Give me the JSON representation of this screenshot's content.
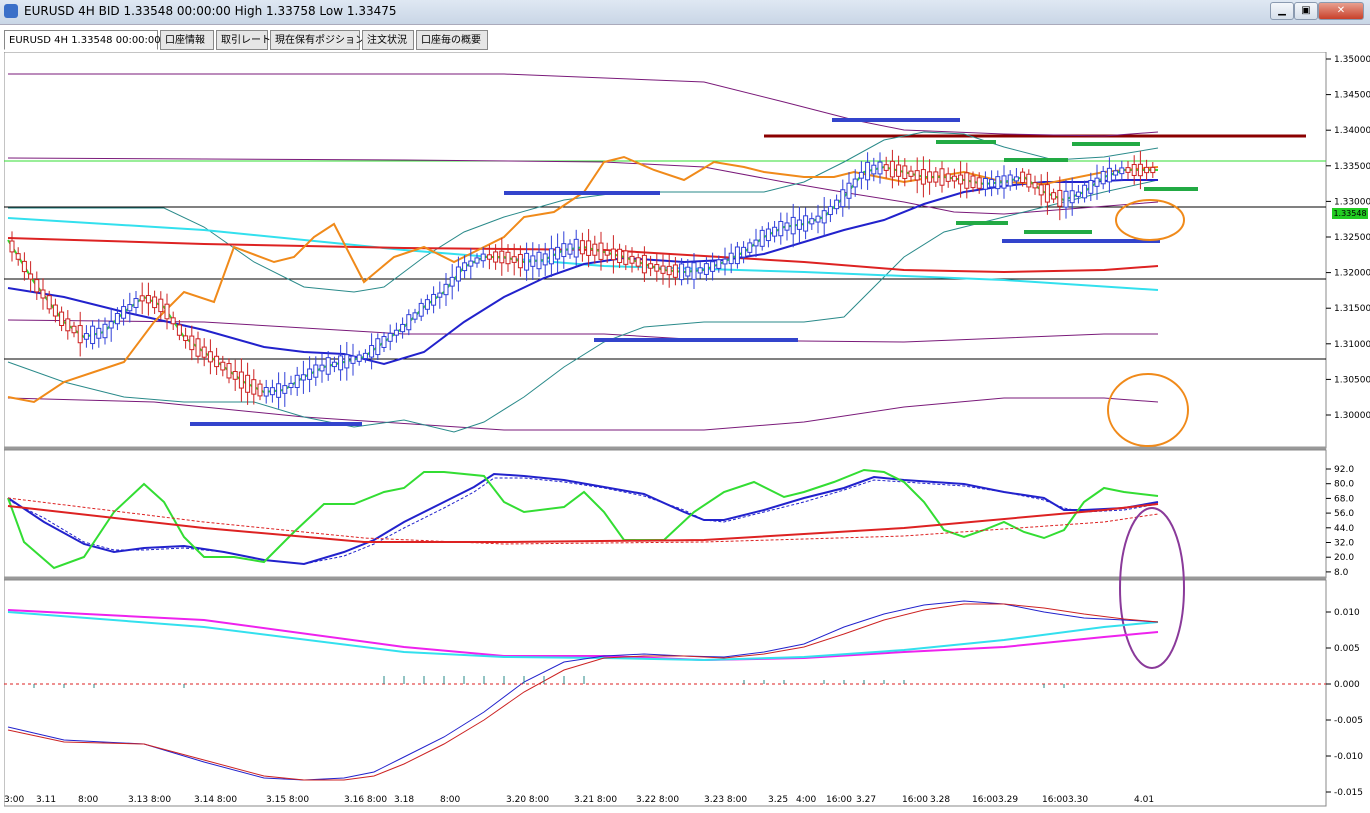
{
  "window": {
    "title": "EURUSD 4H BID 1.33548 00:00:00 High 1.33758 Low 1.33475"
  },
  "tabs": [
    {
      "label": "EURUSD 4H 1.33548 00:00:00"
    },
    {
      "label": "口座情報"
    },
    {
      "label": "取引レート"
    },
    {
      "label": "現在保有ポジション"
    },
    {
      "label": "注文状況"
    },
    {
      "label": "口座毎の概要"
    }
  ],
  "price_panel": {
    "current_price": "1.33548",
    "ticks": [
      "1.35000",
      "1.34500",
      "1.34000",
      "1.33500",
      "1.33000",
      "1.32500",
      "1.32000",
      "1.31500",
      "1.31000",
      "1.30500",
      "1.30000"
    ]
  },
  "stoch_panel": {
    "ticks": [
      "92.0",
      "80.0",
      "68.0",
      "56.0",
      "44.0",
      "32.0",
      "20.0",
      "8.0"
    ]
  },
  "macd_panel": {
    "ticks": [
      "0.010",
      "0.005",
      "0.000",
      "-0.005",
      "-0.010",
      "-0.015"
    ]
  },
  "time_axis": {
    "labels": [
      "3:00",
      "3.11",
      "8:00",
      "3.13 8:00",
      "3.14 8:00",
      "3.15 8:00",
      "3.16 8:00",
      "3.18",
      "8:00",
      "3.20 8:00",
      "3.21 8:00",
      "3.22 8:00",
      "3.23 8:00",
      "3.25",
      "4:00",
      "16:00",
      "3.27",
      "16:00",
      "3.28",
      "16:00",
      "3.29",
      "16:00",
      "3.30",
      "4.01"
    ]
  },
  "colors": {
    "bull_candle": "#2f3fd8",
    "bear_candle": "#cc2222",
    "sma_green": "#33dd33",
    "ma_blue": "#2222cc",
    "ma_red": "#dd2222",
    "ma_cyan": "#33e0ee",
    "orange_line": "#f08a1a",
    "purple_band": "#7a1a7a",
    "teal_band": "#2a8a8a",
    "macd_magenta": "#ee22ee"
  }
}
